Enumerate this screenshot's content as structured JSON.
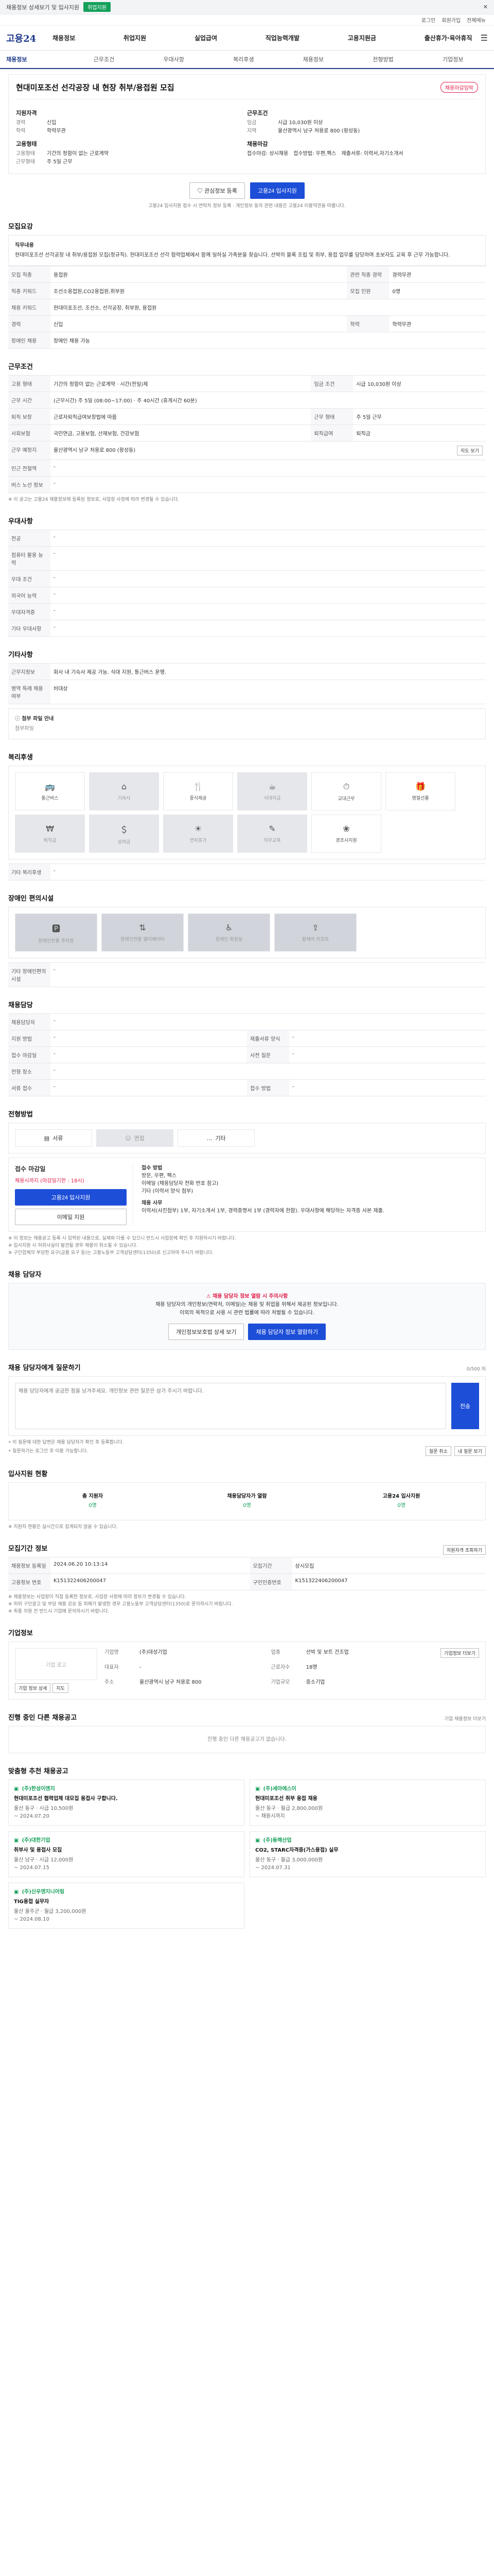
{
  "banner": {
    "text": "채용정보 상세보기 및 입사지원",
    "button": "취업지원",
    "close": "닫기"
  },
  "utility": {
    "login": "로그인",
    "signup": "회원가입",
    "sitemap": "전체메뉴"
  },
  "gnb": {
    "logo": "고용24",
    "menu": [
      "채용정보",
      "취업지원",
      "실업급여",
      "직업능력개발",
      "고용지원금",
      "출산휴가·육아휴직"
    ]
  },
  "subnav": [
    "채용정보",
    "근무조건",
    "우대사항",
    "복리후생",
    "채용정보",
    "전형방법",
    "기업정보"
  ],
  "job": {
    "title": "현대미포조선 선각공장 내 현장 취부/용접원 모집",
    "badge": "채용마감임박",
    "company_h": "지원자격",
    "career_k": "경력",
    "career_v": "신입",
    "edu_k": "학력",
    "edu_v": "학력무관",
    "employ_h": "고용형태",
    "employ_k": "고용형태",
    "employ_v": "기간의 정함이 없는 근로계약",
    "workform_k": "근무형태",
    "workform_v": "주 5일 근무",
    "cond_h": "근무조건",
    "salary_k": "임금",
    "salary_v": "시급 10,030원 이상",
    "place_k": "지역",
    "place_v": "울산광역시 남구 처용로 800 (황성동)",
    "proc_h": "채용마감",
    "proc_items": [
      "접수마감: 상시채용",
      "접수방법: 우편,팩스",
      "제출서류: 이력서,자기소개서"
    ],
    "btn_interest": "관심정보 등록",
    "btn_apply": "고용24 입사지원",
    "note": "고용24 입사지원 접수 시 연락처 정보 등록 · 개인정보 동의 관련 내용은 고용24 이용약관을 따릅니다."
  },
  "detail": {
    "h": "모집요강",
    "content_h": "직무내용",
    "content": "현대미포조선 선각공장 내 취부/용접원 모집(정규직). 현대미포조선 선각 협력업체에서 함께 일하실 가족분을 찾습니다. 선박의 블록 조립 및 취부, 용접 업무를 담당하며 초보자도 교육 후 근무 가능합니다.",
    "rows": [
      {
        "k": "모집 직종",
        "v": "용접원",
        "k2": "관련 직종 경력",
        "v2": "경력무관"
      },
      {
        "k": "직종 키워드",
        "v": "조선소용접원,CO2용접원,취부원",
        "k2": "모집 인원",
        "v2": "0명"
      },
      {
        "k": "채용 키워드",
        "v": "현대미포조선, 조선소, 선각공장, 취부원, 용접원",
        "k2": "",
        "v2": ""
      },
      {
        "k": "경력",
        "v": "신입",
        "k2": "학력",
        "v2": "학력무관"
      },
      {
        "k": "장애인 채용",
        "v": "장애인 채용 가능",
        "k2": "",
        "v2": ""
      }
    ]
  },
  "work": {
    "h": "근무조건",
    "rows": [
      {
        "k": "고용 형태",
        "v": "기간의 정함이 없는 근로계약 · 시간(전일)제",
        "k2": "임금 조건",
        "v2": "시급 10,030원 이상"
      },
      {
        "k": "근무 시간",
        "v": "(근무시간) 주 5일 (08:00~17:00) · 주 40시간 (휴게시간 60분)",
        "k2": "",
        "v2": ""
      },
      {
        "k": "퇴직 보장",
        "v": "근로자퇴직급여보장법에 따름",
        "k2": "근무 형태",
        "v2": "주 5일 근무"
      },
      {
        "k": "사회보험",
        "v": "국민연금, 고용보험, 산재보험, 건강보험",
        "k2": "퇴직급여",
        "v2": "퇴직금"
      },
      {
        "k": "근무 예정지",
        "v": "울산광역시 남구 처용로 800 (황성동)",
        "k2": "",
        "v2": ""
      },
      {
        "k": "인근 전철역",
        "v": "-",
        "k2": "",
        "v2": ""
      },
      {
        "k": "버스 노선 정보",
        "v": "-",
        "k2": "",
        "v2": ""
      }
    ],
    "map_btn": "지도 보기",
    "note": "※ 이 공고는 고용24 채용정보에 등록된 정보로, 사업장 사정에 따라 변경될 수 있습니다."
  },
  "pref": {
    "h": "우대사항",
    "rows": [
      {
        "k": "전공",
        "v": "-"
      },
      {
        "k": "컴퓨터 활용 능력",
        "v": "-"
      },
      {
        "k": "우대 조건",
        "v": "-"
      },
      {
        "k": "외국어 능력",
        "v": "-"
      },
      {
        "k": "우대자격증",
        "v": "-"
      },
      {
        "k": "기타 우대사항",
        "v": "-"
      }
    ]
  },
  "etc": {
    "h": "기타사항",
    "rows": [
      {
        "k": "근무지정보",
        "v": "회사 내 기숙사 제공 가능. 식대 지원, 통근버스 운행."
      },
      {
        "k": "병역 특례 채용 여부",
        "v": "비대상"
      }
    ],
    "attach_h": "첨부 파일 안내",
    "attach_v": "첨부파일"
  },
  "welfare": {
    "h": "복리후생",
    "items": [
      {
        "icon": "parking-icon",
        "label": "통근버스",
        "dim": false
      },
      {
        "icon": "dorm-icon",
        "label": "기숙사",
        "dim": true
      },
      {
        "icon": "meal-icon",
        "label": "중식제공",
        "dim": false
      },
      {
        "icon": "cafe-icon",
        "label": "식대지급",
        "dim": true
      },
      {
        "icon": "clock-icon",
        "label": "교대근무",
        "dim": false
      },
      {
        "icon": "gift-icon",
        "label": "명절선물",
        "dim": false
      },
      {
        "icon": "pension-icon",
        "label": "퇴직금",
        "dim": true
      },
      {
        "icon": "bonus-icon",
        "label": "상여금",
        "dim": true
      },
      {
        "icon": "holiday-icon",
        "label": "연차휴가",
        "dim": true
      },
      {
        "icon": "edu-icon",
        "label": "직무교육",
        "dim": true
      },
      {
        "icon": "family-icon",
        "label": "경조사지원",
        "dim": false
      }
    ],
    "etc_k": "기타 복리후생",
    "etc_v": "-"
  },
  "disab": {
    "h": "장애인 편의시설",
    "items": [
      "장애인전용 주차장",
      "장애인전용 엘리베이터",
      "장애인 화장실",
      "휠체어 리프트"
    ],
    "etc_k": "기타 장애인편의시설",
    "etc_v": "-"
  },
  "recruit": {
    "h": "채용담당",
    "rows": [
      {
        "k": "채용담당자",
        "v": "-",
        "k2": "",
        "v2": ""
      },
      {
        "k": "지원 방법",
        "v": "-",
        "k2": "제출서류 양식",
        "v2": "-"
      },
      {
        "k": "접수 마감일",
        "v": "-",
        "k2": "사전 질문",
        "v2": "-"
      },
      {
        "k": "전형 장소",
        "v": "-",
        "k2": "",
        "v2": ""
      },
      {
        "k": "서류 접수",
        "v": "-",
        "k2": "접수 방법",
        "v2": "-"
      }
    ]
  },
  "method": {
    "h": "전형방법",
    "items": [
      {
        "label": "서류",
        "dim": false
      },
      {
        "label": "면접",
        "dim": true
      },
      {
        "label": "기타",
        "dim": false
      }
    ]
  },
  "apply": {
    "left_title": "접수 마감일",
    "left_deadline": "채용시까지 (마감일기한 : 18시)",
    "btn_apply": "고용24 입사지원",
    "btn_email": "이메일 지원",
    "right_title": "접수 방법",
    "right_lines": [
      "방문, 우편, 팩스",
      "이메일 (채용담당자 전화 번호 참고)",
      "기타 (이력서 양식 첨부)"
    ],
    "right_h2": "채용 사무",
    "right_text": "이력서(사진첨부) 1부, 자기소개서 1부, 경력증명서 1부 (경력자에 한함). 우대사항에 해당하는 자격증 사본 제출.",
    "notes": [
      "※ 이 정보는 채용공고 등록 시 입력된 내용으로, 실제와 다를 수 있으니 반드시 사업장에 확인 후 지원하시기 바랍니다.",
      "※ 입사지원 시 허위사실이 발견될 경우 채용이 취소될 수 있습니다.",
      "※ 구인업체의 부당한 요구(금품 요구 등)는 고용노동부 고객상담센터(1350)로 신고하여 주시기 바랍니다."
    ]
  },
  "contact": {
    "h": "채용 담당자",
    "warn_title": "채용 담당자 정보 열람 시 주의사항",
    "warn_lines": [
      "채용 담당자의 개인정보(연락처, 이메일)는 채용 및 취업을 위해서 제공된 정보입니다.",
      "이외의 목적으로 사용 시 관련 법률에 따라 처벌될 수 있습니다."
    ],
    "btn_public": "개인정보보호법 상세 보기",
    "btn_view": "채용 담당자 정보 열람하기"
  },
  "inquiry": {
    "h": "채용 담당자에게 질문하기",
    "count": "0/500 자",
    "placeholder": "채용 담당자에게 궁금한 점을 남겨주세요. 개인정보 관련 질문은 삼가 주시기 바랍니다.",
    "send": "전송",
    "notes": [
      "• 이 질문에 대한 답변은 채용 담당자가 확인 후 등록합니다.",
      "• 질문하기는 로그인 후 이용 가능합니다."
    ],
    "cancel": "질문 취소",
    "my": "내 질문 보기"
  },
  "status": {
    "h": "입사지원 현황",
    "steps": [
      {
        "label": "총 지원자",
        "value": "0명",
        "sub": "0"
      },
      {
        "label": "채용담당자가 열람",
        "value": "0명",
        "sub": "0"
      },
      {
        "label": "고용24 입사지원",
        "value": "0명",
        "sub": "0"
      }
    ],
    "note": "※ 지원자 현황은 실시간으로 집계되지 않을 수 있습니다."
  },
  "period": {
    "h": "모집기간 정보",
    "btn": "지원자격 조회하기",
    "rows": [
      {
        "k": "채용정보 등록일",
        "v": "2024.06.20 10:13:14",
        "k2": "모집기간",
        "v2": "상시모집"
      },
      {
        "k": "고용정보 번호",
        "v": "K151322406200047",
        "k2": "구인인증번호",
        "v2": "K151322406200047"
      }
    ],
    "notes": [
      "※ 채용정보는 사업장이 직접 등록한 정보로, 사업장 사정에 따라 정보가 변경될 수 있습니다.",
      "※ 허위 구인광고 및 부당 채용 강요 등 피해가 발생한 경우 고용노동부 고객상담센터(1350)로 문의하시기 바랍니다.",
      "※ 최종 지원 전 반드시 기업에 문의하시기 바랍니다."
    ]
  },
  "company": {
    "h": "기업정보",
    "logo": "기업 로고",
    "btn_info": "기업 정보 상세",
    "btn_map": "지도",
    "detail_btn": "기업정보 더보기",
    "fields": [
      {
        "k": "기업명",
        "v": "(주)대성기업"
      },
      {
        "k": "업종",
        "v": "선박 및 보트 건조업"
      },
      {
        "k": "대표자",
        "v": "-"
      },
      {
        "k": "근로자수",
        "v": "18명"
      },
      {
        "k": "주소",
        "v": "울산광역시 남구 처용로 800"
      },
      {
        "k": "기업규모",
        "v": "중소기업"
      }
    ]
  },
  "others": {
    "h": "진행 중인 다른 채용공고",
    "more": "기업 채용정보 더보기",
    "empty": "진행 중인 다른 채용공고가 없습니다."
  },
  "reco": {
    "h": "맞춤형 추천 채용공고",
    "cards": [
      {
        "company": "(주)한성이엔지",
        "title": "현대미포조선 협력업체 대모집 용접사 구합니다.",
        "meta": "울산 동구 · 시급 10,500원",
        "date": "~ 2024.07.20"
      },
      {
        "company": "(주)세아에스이",
        "title": "현대미포조선 취부 용접 채용",
        "meta": "울산 동구 · 월급 2,800,000원",
        "date": "~ 채용시까지"
      },
      {
        "company": "(주)대한기업",
        "title": "취부사 및 용접사 모집",
        "meta": "울산 남구 · 시급 12,000원",
        "date": "~ 2024.07.15"
      },
      {
        "company": "(주)동해산업",
        "title": "CO2, STARC자격증(가스용접) 실무",
        "meta": "울산 동구 · 월급 3,000,000원",
        "date": "~ 2024.07.31"
      },
      {
        "company": "(주)신우엔지니어링",
        "title": "TIG용접 실무자",
        "meta": "울산 울주군 · 월급 3,200,000원",
        "date": "~ 2024.08.10"
      }
    ]
  }
}
